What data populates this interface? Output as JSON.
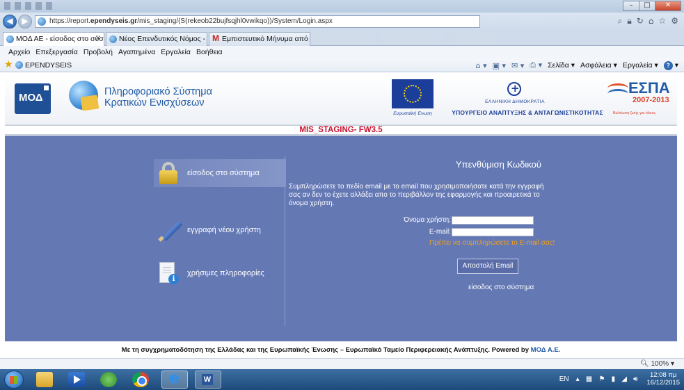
{
  "browser": {
    "address": {
      "protocol": "https://report.",
      "domain": "ependyseis.gr",
      "path": "/mis_staging/(S(rekeob22bujfsqjhl0vwikqo))/System/Login.aspx"
    },
    "tabs": [
      {
        "label": "ΜΟΔ ΑΕ - είσοδος στο σύσ...",
        "active": true
      },
      {
        "label": "Νέος Επενδυτικός Νόμος - 39...",
        "active": false
      },
      {
        "label": "Εμπιστευτικό Μήνυμα από το ...",
        "active": false
      }
    ],
    "menu": [
      "Αρχείο",
      "Επεξεργασία",
      "Προβολή",
      "Αγαπημένα",
      "Εργαλεία",
      "Βοήθεια"
    ],
    "favorites": [
      "EPENDYSEIS"
    ],
    "commands": {
      "page": "Σελίδα",
      "safety": "Ασφάλεια",
      "tools": "Εργαλεία"
    },
    "zoom": "100%"
  },
  "header": {
    "logo": "ΜΟΔ",
    "system_title_line1": "Πληροφοριακό Σύστημα",
    "system_title_line2": "Κρατικών Ενισχύσεων",
    "eu_label": "Ευρωπαϊκή Ένωση",
    "republic": "ΕΛΛΗΝΙΚΗ ΔΗΜΟΚΡΑΤΙΑ",
    "ministry": "ΥΠΟΥΡΓΕΙΟ ΑΝΑΠΤΥΞΗΣ & ΑΝΤΑΓΩΝΙΣΤΙΚΟΤΗΤΑΣ",
    "espa": "ΕΣΠΑ",
    "espa_years": "2007-2013",
    "espa_tagline": "Βελτίωση ζωής για όλους",
    "environment": "MIS_STAGING- FW3.5"
  },
  "side_menu": [
    {
      "label": "είσοδος στο σύστημα",
      "icon": "lock-icon",
      "active": true
    },
    {
      "label": "εγγραφή νέου χρήστη",
      "icon": "pencil-icon",
      "active": false
    },
    {
      "label": "χρήσιμες πληροφορίες",
      "icon": "info-document-icon",
      "active": false
    }
  ],
  "form": {
    "title": "Υπενθύμιση Κωδικού",
    "description": "Συμπληρώσετε το πεδίο email με το email που χρησιμοποιήσατε κατά την εγγραφή σας αν δεν το έχετε αλλάξει απο το περιβάλλον της εφαρμογής και προαιρετικά το όνομα χρήστη.",
    "username_label": "Όνομα χρήστη:",
    "username_value": "",
    "email_label": "E-mail:",
    "email_value": "",
    "error": "Πρέπει να συμπληρώσετε το E-mail σας!",
    "send_button": "Αποστολή Email",
    "login_link": "είσοδος στο σύστημα"
  },
  "footer": {
    "text": "Με τη συγχρηματοδότηση της Ελλάδας και της Ευρωπαϊκής Ένωσης – Ευρωπαϊκό Ταμείο Περιφερειακής Ανάπτυξης.  Powered by ",
    "brand": "ΜΟΔ Α.Ε."
  },
  "taskbar": {
    "lang": "EN",
    "time": "12:08 πμ",
    "date": "16/12/2015"
  },
  "colors": {
    "panel": "#6478b4",
    "staging_red": "#c8102e",
    "error_orange": "#f0a020",
    "brand_blue": "#1f5aa7"
  }
}
